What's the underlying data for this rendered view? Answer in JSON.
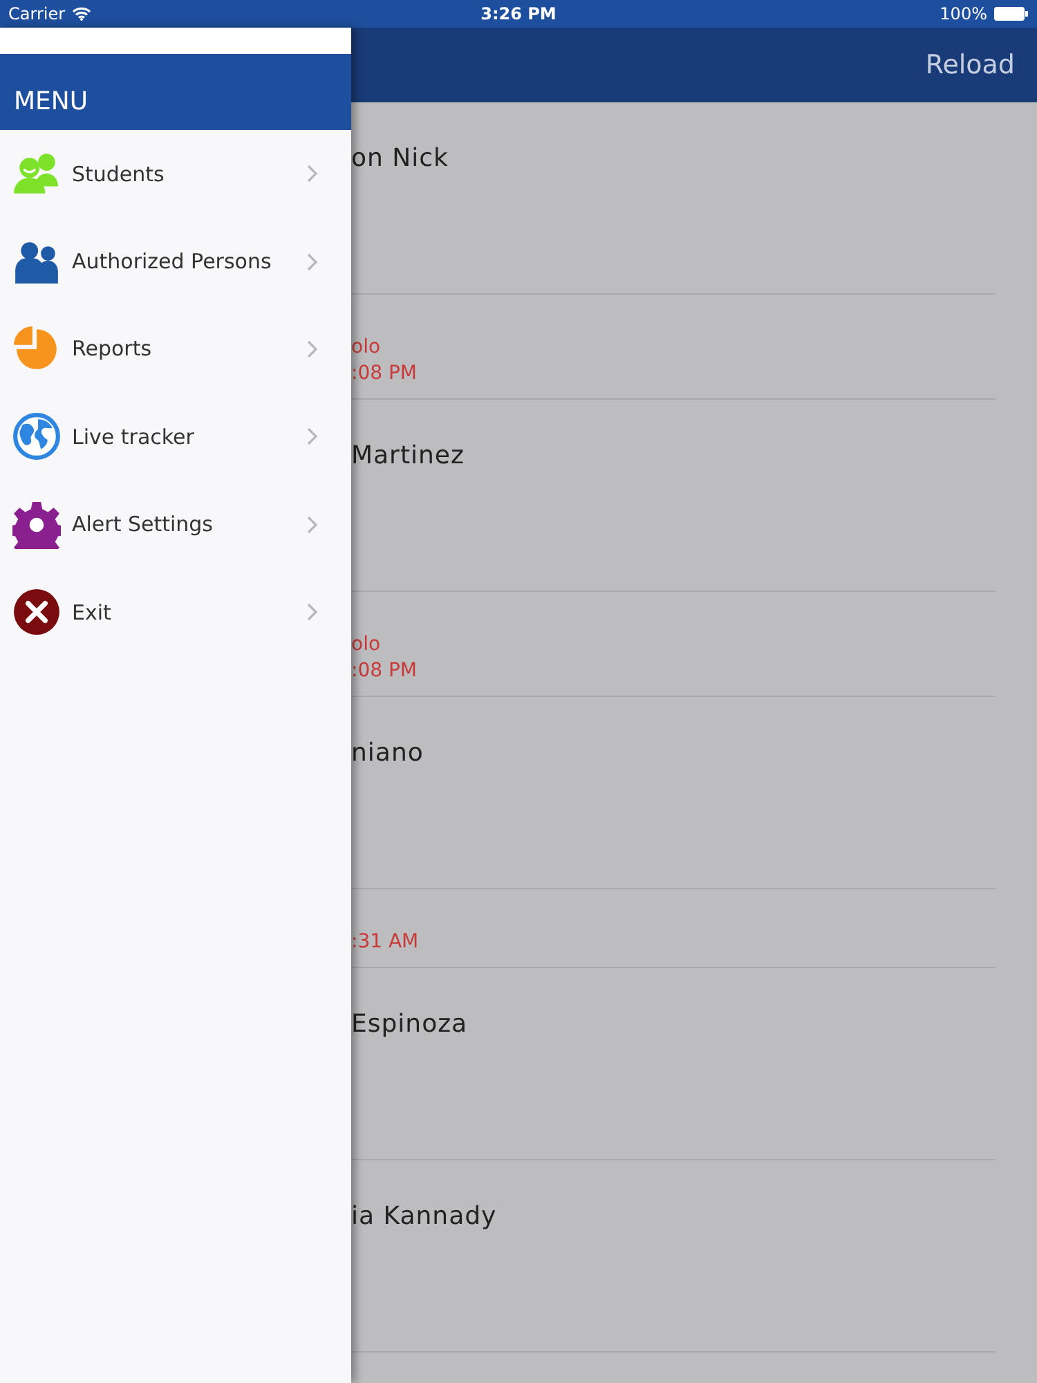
{
  "status_bar": {
    "carrier": "Carrier",
    "time": "3:26 PM",
    "battery": "100%"
  },
  "menu": {
    "title": "MENU",
    "items": [
      {
        "kind": "students",
        "label": "Students"
      },
      {
        "kind": "persons",
        "label": "Authorized Persons"
      },
      {
        "kind": "reports",
        "label": "Reports"
      },
      {
        "kind": "tracker",
        "label": "Live tracker"
      },
      {
        "kind": "settings",
        "label": "Alert Settings"
      },
      {
        "kind": "exit",
        "label": "Exit"
      }
    ]
  },
  "nav_bar": {
    "action": "Reload"
  },
  "list": [
    {
      "kind": "name",
      "text": "on Nick"
    },
    {
      "kind": "info",
      "lines": [
        "olo",
        ":08 PM"
      ]
    },
    {
      "kind": "name",
      "text": "Martinez"
    },
    {
      "kind": "info",
      "lines": [
        "olo",
        ":08 PM"
      ]
    },
    {
      "kind": "name",
      "text": "niano"
    },
    {
      "kind": "info",
      "lines": [
        ":31 AM"
      ]
    },
    {
      "kind": "name",
      "text": "Espinoza"
    },
    {
      "kind": "name",
      "text": "ia Kannady"
    }
  ]
}
